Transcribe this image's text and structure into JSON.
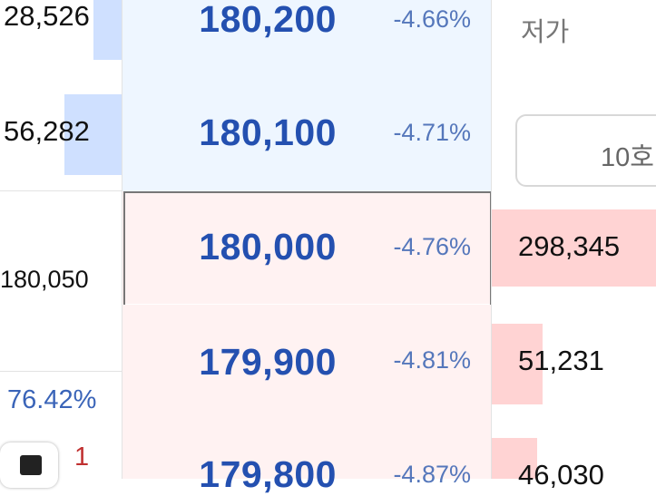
{
  "left_quantities": [
    {
      "value": "28,526",
      "bar_fraction": 0.22
    },
    {
      "value": "56,282",
      "bar_fraction": 0.46
    }
  ],
  "reference_price": "180,050",
  "ratio": "76.42%",
  "count_badge": "1",
  "price_levels": [
    {
      "price": "180,200",
      "change": "-4.66%",
      "side": "ask"
    },
    {
      "price": "180,100",
      "change": "-4.71%",
      "side": "ask"
    },
    {
      "price": "180,000",
      "change": "-4.76%",
      "side": "bid",
      "selected": true
    },
    {
      "price": "179,900",
      "change": "-4.81%",
      "side": "bid"
    },
    {
      "price": "179,800",
      "change": "-4.87%",
      "side": "bid"
    }
  ],
  "bid_quantities": [
    {
      "value": "298,345",
      "bar_fraction": 1.0
    },
    {
      "value": "51,231",
      "bar_fraction": 0.31
    },
    {
      "value": "46,030",
      "bar_fraction": 0.27
    }
  ],
  "low_label": "저가",
  "order_button_label": "10호",
  "colors": {
    "price_blue": "#2450b0",
    "ask_bg": "#eef6ff",
    "bid_bg": "#fff2f2",
    "ask_bar": "#cfe0ff",
    "bid_bar": "#ffd3d3",
    "selected_border": "#777777"
  }
}
